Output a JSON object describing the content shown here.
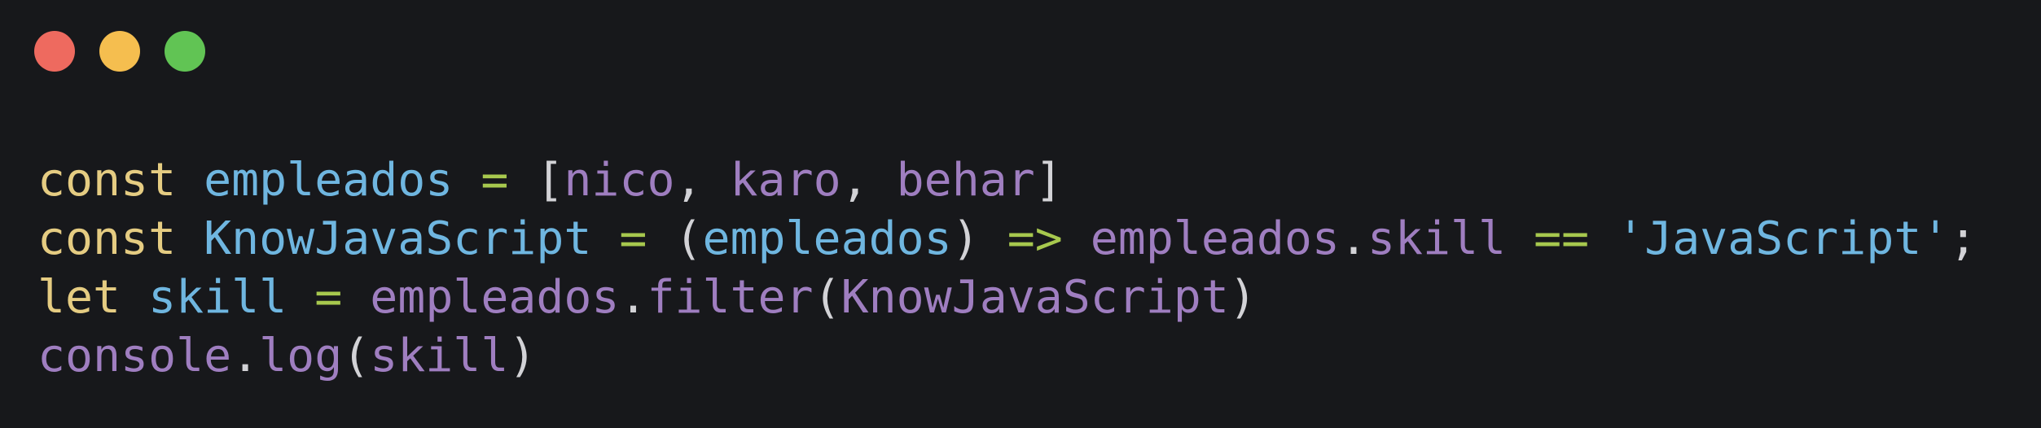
{
  "window": {
    "background": "#17181b",
    "controls": [
      {
        "name": "close",
        "color": "#ee6a5f"
      },
      {
        "name": "minimize",
        "color": "#f5be4f"
      },
      {
        "name": "zoom",
        "color": "#61c454"
      }
    ]
  },
  "palette": {
    "keyword": "#e5cc82",
    "variable": "#6fb6e0",
    "operator": "#a7c84e",
    "identifier": "#9f7ec0",
    "punctuation": "#d2d2d6",
    "string": "#6fb6e0"
  },
  "code": {
    "lines": [
      [
        {
          "t": "const",
          "c": "keyword"
        },
        {
          "t": " ",
          "c": "punctuation"
        },
        {
          "t": "empleados",
          "c": "variable"
        },
        {
          "t": " ",
          "c": "punctuation"
        },
        {
          "t": "=",
          "c": "operator"
        },
        {
          "t": " ",
          "c": "punctuation"
        },
        {
          "t": "[",
          "c": "punctuation"
        },
        {
          "t": "nico",
          "c": "identifier"
        },
        {
          "t": ", ",
          "c": "punctuation"
        },
        {
          "t": "karo",
          "c": "identifier"
        },
        {
          "t": ", ",
          "c": "punctuation"
        },
        {
          "t": "behar",
          "c": "identifier"
        },
        {
          "t": "]",
          "c": "punctuation"
        }
      ],
      [
        {
          "t": "const",
          "c": "keyword"
        },
        {
          "t": " ",
          "c": "punctuation"
        },
        {
          "t": "KnowJavaScript",
          "c": "variable"
        },
        {
          "t": " ",
          "c": "punctuation"
        },
        {
          "t": "=",
          "c": "operator"
        },
        {
          "t": " ",
          "c": "punctuation"
        },
        {
          "t": "(",
          "c": "punctuation"
        },
        {
          "t": "empleados",
          "c": "variable"
        },
        {
          "t": ")",
          "c": "punctuation"
        },
        {
          "t": " ",
          "c": "punctuation"
        },
        {
          "t": "=>",
          "c": "operator"
        },
        {
          "t": " ",
          "c": "punctuation"
        },
        {
          "t": "empleados",
          "c": "identifier"
        },
        {
          "t": ".",
          "c": "punctuation"
        },
        {
          "t": "skill",
          "c": "identifier"
        },
        {
          "t": " ",
          "c": "punctuation"
        },
        {
          "t": "==",
          "c": "operator"
        },
        {
          "t": " ",
          "c": "punctuation"
        },
        {
          "t": "'JavaScript'",
          "c": "string"
        },
        {
          "t": ";",
          "c": "punctuation"
        }
      ],
      [
        {
          "t": "let",
          "c": "keyword"
        },
        {
          "t": " ",
          "c": "punctuation"
        },
        {
          "t": "skill",
          "c": "variable"
        },
        {
          "t": " ",
          "c": "punctuation"
        },
        {
          "t": "=",
          "c": "operator"
        },
        {
          "t": " ",
          "c": "punctuation"
        },
        {
          "t": "empleados",
          "c": "identifier"
        },
        {
          "t": ".",
          "c": "punctuation"
        },
        {
          "t": "filter",
          "c": "identifier"
        },
        {
          "t": "(",
          "c": "punctuation"
        },
        {
          "t": "KnowJavaScript",
          "c": "identifier"
        },
        {
          "t": ")",
          "c": "punctuation"
        }
      ],
      [
        {
          "t": "console",
          "c": "identifier"
        },
        {
          "t": ".",
          "c": "punctuation"
        },
        {
          "t": "log",
          "c": "identifier"
        },
        {
          "t": "(",
          "c": "punctuation"
        },
        {
          "t": "skill",
          "c": "identifier"
        },
        {
          "t": ")",
          "c": "punctuation"
        }
      ]
    ]
  }
}
